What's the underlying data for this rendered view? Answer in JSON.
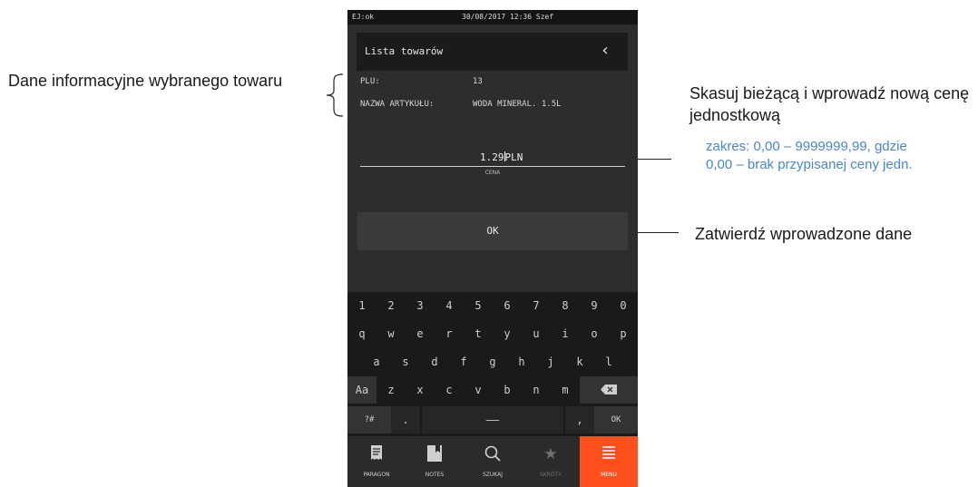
{
  "annotations": {
    "left_info": "Dane informacyjne wybranego towaru",
    "price_title": "Skasuj bieżącą i wprowadź nową cenę jednostkową",
    "price_range": "zakres:  0,00 – 9999999,99, gdzie",
    "price_note": "0,00 – brak przypisanej ceny jedn.",
    "confirm": "Zatwierdź wprowadzone dane"
  },
  "status": {
    "left": "EJ:ok",
    "center": "30/08/2017  12:36  Szef"
  },
  "header": {
    "title": "Lista towarów",
    "back_icon": "chevron-left-icon"
  },
  "product": {
    "plu_label": "PLU:",
    "plu_value": "13",
    "name_label": "NAZWA ARTYKUŁU:",
    "name_value": "WODA MINERAL. 1.5L"
  },
  "price": {
    "value": "1.29",
    "currency": "PLN",
    "caption": "CENA"
  },
  "ok_label": "OK",
  "keyboard": {
    "row1": [
      "1",
      "2",
      "3",
      "4",
      "5",
      "6",
      "7",
      "8",
      "9",
      "0"
    ],
    "row2": [
      "q",
      "w",
      "e",
      "r",
      "t",
      "y",
      "u",
      "i",
      "o",
      "p"
    ],
    "row3": [
      "a",
      "s",
      "d",
      "f",
      "g",
      "h",
      "j",
      "k",
      "l"
    ],
    "row4_shift": "Aa",
    "row4": [
      "z",
      "x",
      "c",
      "v",
      "b",
      "n",
      "m"
    ],
    "row4_backspace_icon": "backspace-icon",
    "row5_symbols": "?#",
    "row5_dot": ".",
    "row5_space": "——",
    "row5_comma": ",",
    "row5_ok": "OK"
  },
  "nav": [
    {
      "label": "PARAGON",
      "icon": "receipt-icon"
    },
    {
      "label": "NOTES",
      "icon": "notes-icon"
    },
    {
      "label": "SZUKAJ",
      "icon": "search-icon"
    },
    {
      "label": "SKRÓTY",
      "icon": "star-icon"
    },
    {
      "label": "MENU",
      "icon": "menu-icon"
    }
  ],
  "colors": {
    "accent": "#ff4f1c",
    "annotation_blue": "#4a86c8",
    "screen_bg": "#2d2d2d"
  }
}
